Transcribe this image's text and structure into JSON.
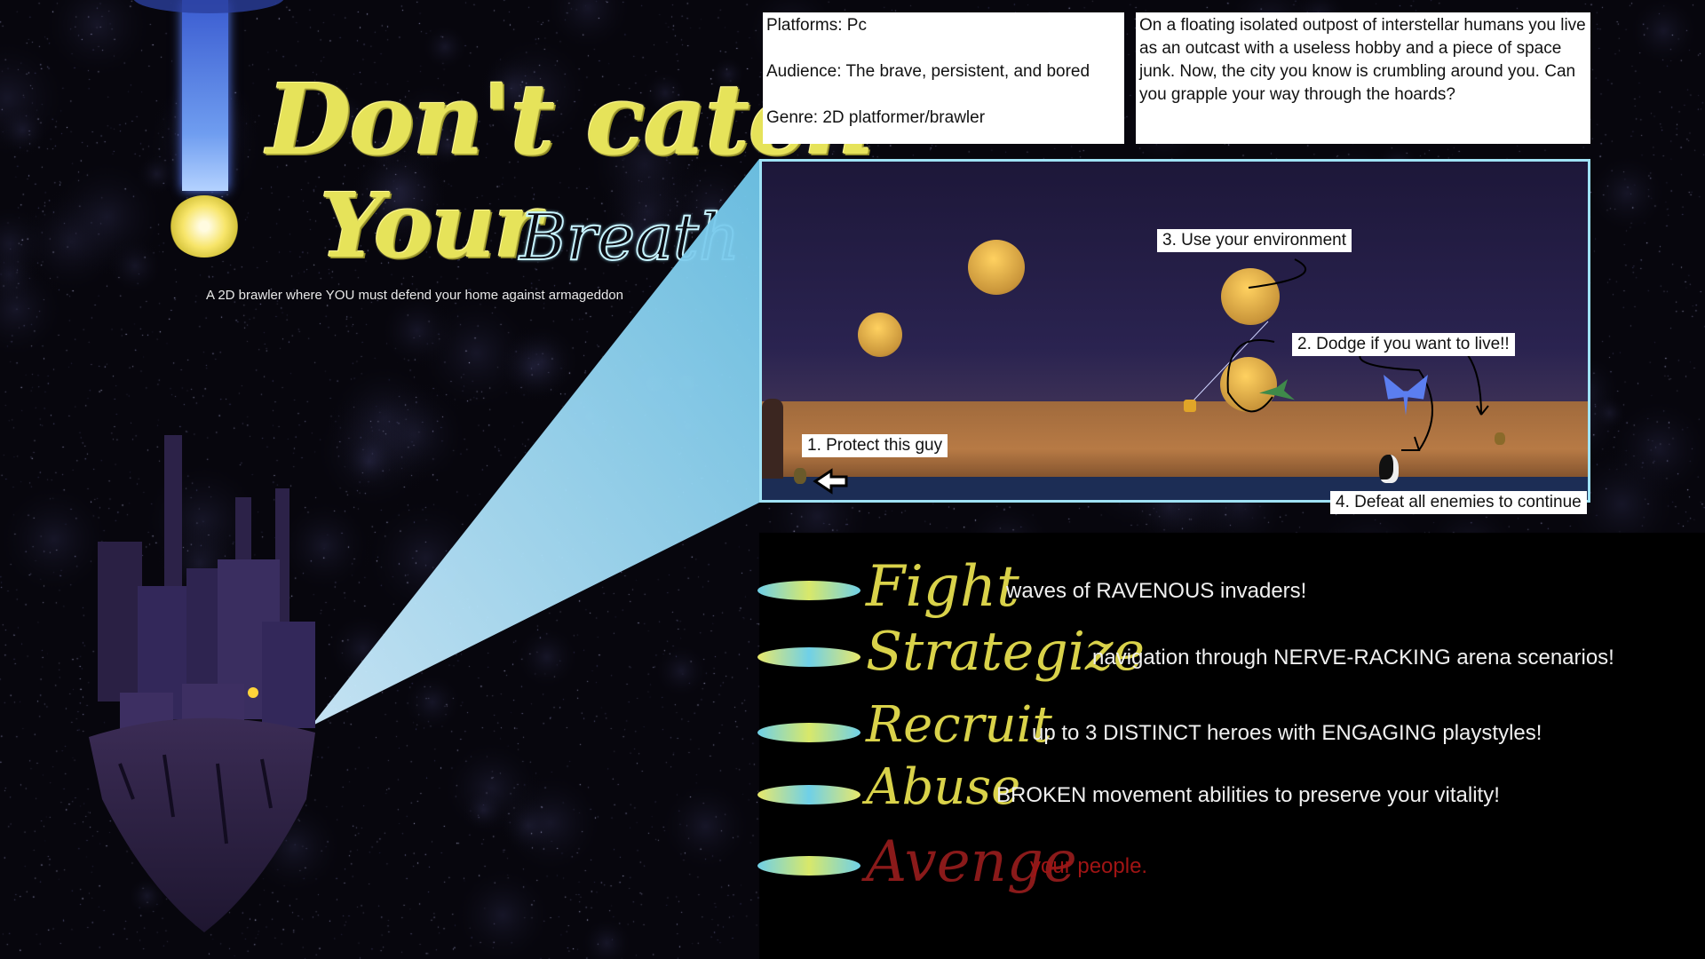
{
  "title": {
    "line1": "Don't catch",
    "line2": "Your",
    "breath": "Breath",
    "tagline": "A 2D brawler where YOU must defend your home against armageddon"
  },
  "info": {
    "platforms": "Platforms: Pc",
    "audience": "Audience: The brave, persistent, and bored",
    "genre": "Genre: 2D platformer/brawler",
    "story": "On a floating isolated outpost of interstellar humans you live as an outcast with a useless hobby and a piece of space junk. Now, the city you know is crumbling around you. Can you grapple your way through the hoards?"
  },
  "callouts": {
    "protect": "1. Protect this guy",
    "dodge": "2. Dodge if you want to live!!",
    "environment": "3. Use your environment",
    "defeat": "4. Defeat all enemies to continue"
  },
  "features": [
    {
      "word": "Fight",
      "desc": "waves of RAVENOUS invaders!",
      "word_color": "#d9d24a",
      "desc_color": "#f0f0f0",
      "pill": "cyan-yellow"
    },
    {
      "word": "Strategize",
      "desc": "navigation through NERVE-RACKING arena scenarios!",
      "word_color": "#d9d24a",
      "desc_color": "#f0f0f0",
      "pill": "yellow-cyan"
    },
    {
      "word": "Recruit",
      "desc": "up to 3 DISTINCT heroes with ENGAGING playstyles!",
      "word_color": "#d9d24a",
      "desc_color": "#f0f0f0",
      "pill": "cyan-yellow"
    },
    {
      "word": "Abuse",
      "desc": "BROKEN movement abilities to preserve your vitality!",
      "word_color": "#d9d24a",
      "desc_color": "#f0f0f0",
      "pill": "yellow-cyan"
    },
    {
      "word": "Avenge",
      "desc": "your people.",
      "word_color": "#8a1a1a",
      "desc_color": "#a01414",
      "pill": "cyan-yellow"
    }
  ],
  "colors": {
    "title_yellow": "#e6e35a",
    "accent_cyan": "#9fe2f5",
    "background": "#07060d"
  }
}
